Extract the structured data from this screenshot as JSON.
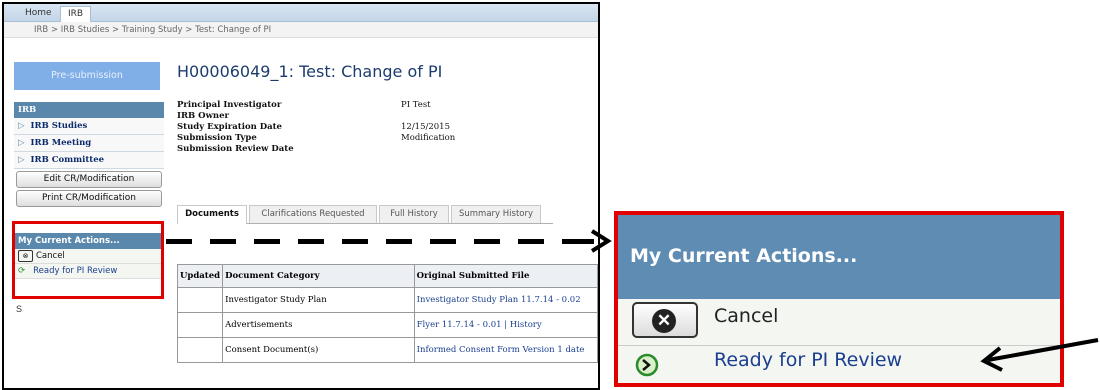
{
  "top_tabs": [
    "Home",
    "IRB"
  ],
  "breadcrumb": "IRB > IRB Studies > Training Study > Test: Change of PI",
  "presubmission_button": "Pre-submission",
  "sidebar": {
    "section_title": "IRB",
    "items": [
      "IRB Studies",
      "IRB Meeting",
      "IRB Committee"
    ],
    "buttons": [
      "Edit CR/Modification",
      "Print CR/Modification"
    ],
    "actions_title": "My Current Actions...",
    "actions": [
      {
        "label": "Cancel",
        "icon": "cancel-icon"
      },
      {
        "label": "Ready for PI Review",
        "icon": "green-arrow-icon"
      }
    ],
    "stray_text": "S"
  },
  "page_title": "H00006049_1: Test: Change of PI",
  "details": [
    {
      "label": "Principal Investigator",
      "value": "PI Test"
    },
    {
      "label": "IRB Owner",
      "value": ""
    },
    {
      "label": "Study Expiration Date",
      "value": "12/15/2015"
    },
    {
      "label": "Submission Type",
      "value": "Modification"
    },
    {
      "label": "Submission Review Date",
      "value": ""
    }
  ],
  "tabs": [
    "Documents",
    "Clarifications Requested",
    "Full History",
    "Summary History"
  ],
  "active_tab": "Documents",
  "table": {
    "headers": [
      "Updated",
      "Document Category",
      "Original Submitted File"
    ],
    "rows": [
      {
        "updated": "",
        "category": "Investigator Study Plan",
        "file": "Investigator Study Plan 11.7.14 - 0.02"
      },
      {
        "updated": "",
        "category": "Advertisements",
        "file": "Flyer 11.7.14 - 0.01 | History"
      },
      {
        "updated": "",
        "category": "Consent Document(s)",
        "file": "Informed Consent Form Version 1 date"
      }
    ]
  },
  "zoom": {
    "title": "My Current Actions...",
    "cancel": "Cancel",
    "ready": "Ready for PI Review"
  },
  "colors": {
    "highlight": "#e00000",
    "header_blue": "#5f8cb3",
    "link": "#1a3f8f"
  }
}
